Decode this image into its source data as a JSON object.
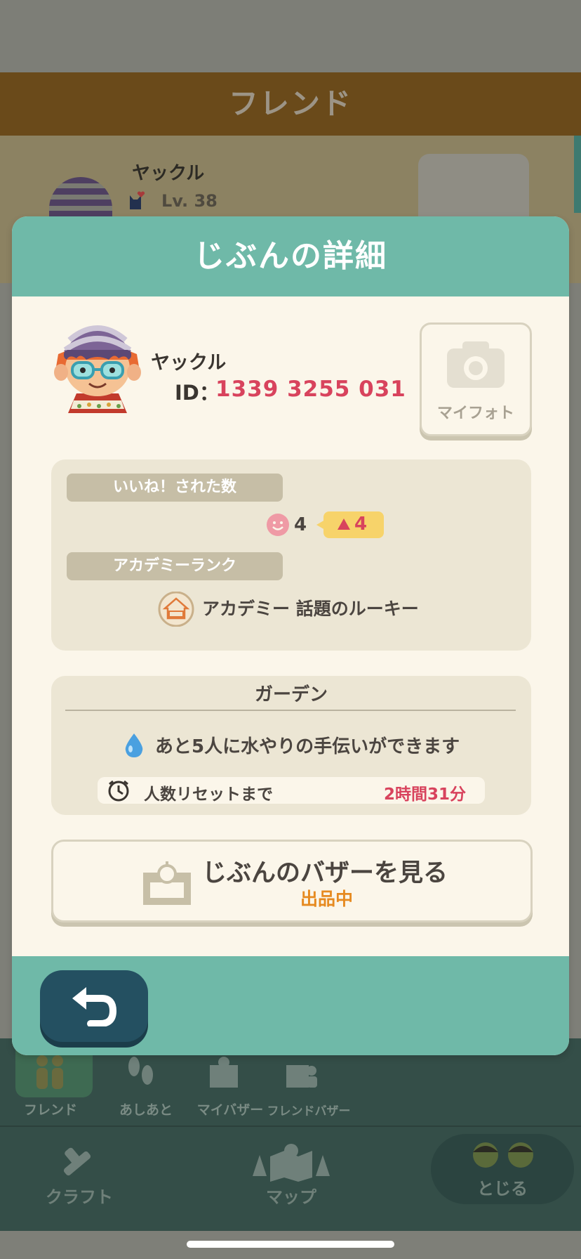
{
  "background": {
    "header_title": "フレンド",
    "friend": {
      "name": "ヤックル",
      "level": "Lv. 38"
    },
    "tabs": [
      {
        "label": "フレンド",
        "active": true,
        "badge": true
      },
      {
        "label": "あしあと",
        "active": false,
        "badge": true
      },
      {
        "label": "マイバザー",
        "active": false,
        "badge": false
      },
      {
        "label": "フレンドバザー",
        "active": false,
        "badge": false
      }
    ],
    "nav": {
      "craft": "クラフト",
      "map": "マップ",
      "close": "とじる"
    }
  },
  "modal": {
    "title": "じぶんの詳細",
    "profile": {
      "name": "ヤックル",
      "id_label": "ID：",
      "id_value": "1339 3255 031"
    },
    "my_photo_label": "マイフォト",
    "likes": {
      "label": "いいね！された数",
      "count": "4",
      "increase": "4"
    },
    "academy": {
      "label": "アカデミーランク",
      "rank": "アカデミー 話題のルーキー"
    },
    "garden": {
      "title": "ガーデン",
      "water_text": "あと5人に水やりの手伝いができます",
      "reset_label": "人数リセットまで",
      "reset_time": "2時間31分"
    },
    "bazaar": {
      "title": "じぶんのバザーを見る",
      "status": "出品中"
    }
  },
  "colors": {
    "accent": "#6fb9a8",
    "highlight": "#d8435d",
    "status": "#e68a20",
    "back_button": "#245061"
  }
}
